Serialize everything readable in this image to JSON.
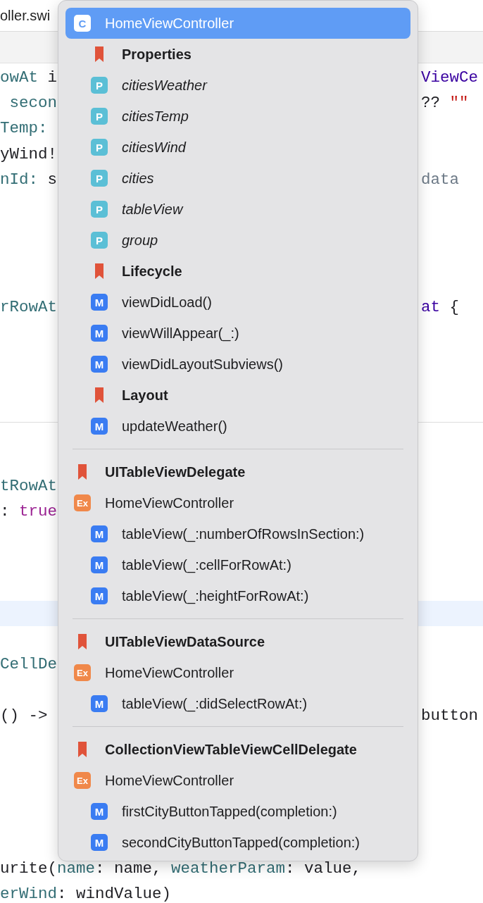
{
  "editor": {
    "tab_title": "oller.swi",
    "lines": [
      {
        "kind": "code",
        "left": [
          {
            "text": "owAt",
            "color": "#326d74"
          },
          {
            "text": " i",
            "color": "#1f1f24"
          }
        ],
        "right": [
          {
            "text": "ViewCe",
            "color": "#3900a0"
          }
        ]
      },
      {
        "kind": "code",
        "left": [
          {
            "text": " secon",
            "color": "#326d74"
          }
        ],
        "right": [
          {
            "text": "?? ",
            "color": "#1f1f24"
          },
          {
            "text": "\"\"",
            "color": "#c41a16"
          }
        ]
      },
      {
        "kind": "code",
        "left": [
          {
            "text": "Temp:",
            "color": "#326d74"
          }
        ]
      },
      {
        "kind": "code",
        "left": [
          {
            "text": "yWind!",
            "color": "#1f1f24"
          }
        ]
      },
      {
        "kind": "code",
        "left": [
          {
            "text": "nId:",
            "color": "#326d74"
          },
          {
            "text": " s",
            "color": "#1f1f24"
          }
        ],
        "right": [
          {
            "text": "data",
            "color": "#6c7986"
          }
        ]
      },
      {
        "kind": "blank"
      },
      {
        "kind": "blank"
      },
      {
        "kind": "blank"
      },
      {
        "kind": "blank"
      },
      {
        "kind": "code",
        "left": [
          {
            "text": "rRowAt",
            "color": "#326d74"
          }
        ],
        "right": [
          {
            "text": "at",
            "color": "#3900a0"
          },
          {
            "text": " {",
            "color": "#1f1f24"
          }
        ]
      },
      {
        "kind": "blank"
      },
      {
        "kind": "blank"
      },
      {
        "kind": "blank"
      },
      {
        "kind": "blank"
      },
      {
        "kind": "divider"
      },
      {
        "kind": "blank"
      },
      {
        "kind": "blank"
      },
      {
        "kind": "code",
        "left": [
          {
            "text": "tRowAt",
            "color": "#326d74"
          }
        ]
      },
      {
        "kind": "code",
        "left": [
          {
            "text": ": ",
            "color": "#1f1f24"
          },
          {
            "text": "true",
            "color": "#9b2393"
          }
        ]
      },
      {
        "kind": "blank"
      },
      {
        "kind": "blank"
      },
      {
        "kind": "blank"
      },
      {
        "kind": "current"
      },
      {
        "kind": "blank"
      },
      {
        "kind": "code",
        "left": [
          {
            "text": "CellDe",
            "color": "#326d74"
          }
        ]
      },
      {
        "kind": "blank"
      },
      {
        "kind": "code",
        "left": [
          {
            "text": "() ->",
            "color": "#1f1f24"
          }
        ],
        "right": [
          {
            "text": "button",
            "color": "#1f1f24"
          }
        ]
      },
      {
        "kind": "blank"
      },
      {
        "kind": "blank"
      },
      {
        "kind": "blank"
      },
      {
        "kind": "blank"
      },
      {
        "kind": "blank"
      },
      {
        "kind": "code",
        "left": [
          {
            "text": "urite(",
            "color": "#1f1f24"
          },
          {
            "text": "name",
            "color": "#326d74"
          },
          {
            "text": ": name, ",
            "color": "#1f1f24"
          },
          {
            "text": "weatherParam",
            "color": "#326d74"
          },
          {
            "text": ": value,",
            "color": "#1f1f24"
          }
        ]
      },
      {
        "kind": "code",
        "left": [
          {
            "text": "erWind",
            "color": "#326d74"
          },
          {
            "text": ": windValue)",
            "color": "#1f1f24"
          }
        ]
      }
    ]
  },
  "symbol_menu": {
    "groups": [
      {
        "items": [
          {
            "kind": "class",
            "badge": "C",
            "label": "HomeViewController",
            "selected": true,
            "children": [
              {
                "kind": "mark",
                "label": "Properties",
                "selected": false
              },
              {
                "kind": "property",
                "badge": "P",
                "label": "citiesWeather",
                "selected": false
              },
              {
                "kind": "property",
                "badge": "P",
                "label": "citiesTemp",
                "selected": false
              },
              {
                "kind": "property",
                "badge": "P",
                "label": "citiesWind",
                "selected": false
              },
              {
                "kind": "property",
                "badge": "P",
                "label": "cities",
                "selected": false
              },
              {
                "kind": "property",
                "badge": "P",
                "label": "tableView",
                "selected": false
              },
              {
                "kind": "property",
                "badge": "P",
                "label": "group",
                "selected": false
              },
              {
                "kind": "mark",
                "label": "Lifecycle",
                "selected": false
              },
              {
                "kind": "method",
                "badge": "M",
                "label": "viewDidLoad()",
                "selected": false
              },
              {
                "kind": "method",
                "badge": "M",
                "label": "viewWillAppear(_:)",
                "selected": false
              },
              {
                "kind": "method",
                "badge": "M",
                "label": "viewDidLayoutSubviews()",
                "selected": false
              },
              {
                "kind": "mark",
                "label": "Layout",
                "selected": false
              },
              {
                "kind": "method",
                "badge": "M",
                "label": "updateWeather()",
                "selected": false
              }
            ]
          }
        ]
      },
      {
        "items": [
          {
            "kind": "mark",
            "label": "UITableViewDelegate",
            "selected": false
          },
          {
            "kind": "extension",
            "badge": "Ex",
            "label": "HomeViewController",
            "selected": false,
            "children": [
              {
                "kind": "method",
                "badge": "M",
                "label": "tableView(_:numberOfRowsInSection:)",
                "selected": false
              },
              {
                "kind": "method",
                "badge": "M",
                "label": "tableView(_:cellForRowAt:)",
                "selected": false
              },
              {
                "kind": "method",
                "badge": "M",
                "label": "tableView(_:heightForRowAt:)",
                "selected": false
              }
            ]
          }
        ]
      },
      {
        "items": [
          {
            "kind": "mark",
            "label": "UITableViewDataSource",
            "selected": false
          },
          {
            "kind": "extension",
            "badge": "Ex",
            "label": "HomeViewController",
            "selected": false,
            "children": [
              {
                "kind": "method",
                "badge": "M",
                "label": "tableView(_:didSelectRowAt:)",
                "selected": false
              }
            ]
          }
        ]
      },
      {
        "items": [
          {
            "kind": "mark",
            "label": "CollectionViewTableViewCellDelegate",
            "selected": false
          },
          {
            "kind": "extension",
            "badge": "Ex",
            "label": "HomeViewController",
            "selected": false,
            "children": [
              {
                "kind": "method",
                "badge": "M",
                "label": "firstCityButtonTapped(completion:)",
                "selected": false
              },
              {
                "kind": "method",
                "badge": "M",
                "label": "secondCityButtonTapped(completion:)",
                "selected": false
              }
            ]
          }
        ]
      }
    ]
  }
}
